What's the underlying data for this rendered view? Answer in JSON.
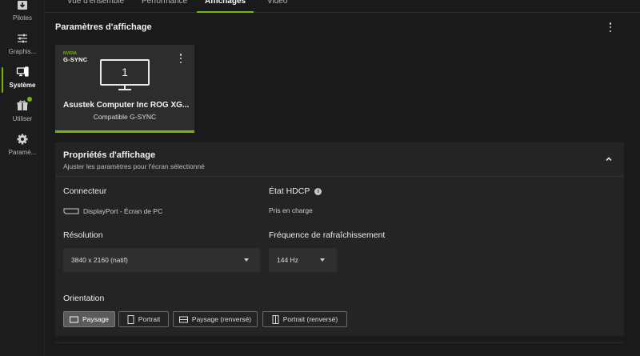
{
  "sidebar": {
    "items": [
      {
        "label": "Pilotes",
        "icon": "drivers-icon"
      },
      {
        "label": "Graphis...",
        "icon": "sliders-icon"
      },
      {
        "label": "Système",
        "icon": "system-icon",
        "active": true
      },
      {
        "label": "Utiliser",
        "icon": "gift-icon",
        "badge": true
      },
      {
        "label": "Paramè...",
        "icon": "gear-icon"
      }
    ]
  },
  "tabs": [
    {
      "label": "Vue d'ensemble"
    },
    {
      "label": "Performance"
    },
    {
      "label": "Affichages",
      "active": true
    },
    {
      "label": "Vidéo"
    }
  ],
  "section": {
    "title": "Paramètres d'affichage"
  },
  "display_card": {
    "brand_top": "NVIDIA",
    "brand": "G-SYNC",
    "monitor_number": "1",
    "name": "Asustek Computer Inc ROG XG...",
    "subtitle": "Compatible G-SYNC"
  },
  "panel": {
    "title": "Propriétés d'affichage",
    "subtitle": "Ajuster les paramètres pour l'écran sélectionné",
    "connector_label": "Connecteur",
    "connector_value": "DisplayPort - Écran de PC",
    "hdcp_label": "État HDCP",
    "hdcp_value": "Pris en charge",
    "resolution_label": "Résolution",
    "resolution_value": "3840 x 2160 (natif)",
    "refresh_label": "Fréquence de rafraîchissement",
    "refresh_value": "144 Hz",
    "orientation_label": "Orientation",
    "orientation_options": [
      {
        "label": "Paysage",
        "selected": true
      },
      {
        "label": "Portrait"
      },
      {
        "label": "Paysage (renversé)"
      },
      {
        "label": "Portrait (renversé)"
      }
    ]
  },
  "colors": {
    "accent": "#76b900",
    "background": "#1a1a1a",
    "panel": "#242424"
  }
}
